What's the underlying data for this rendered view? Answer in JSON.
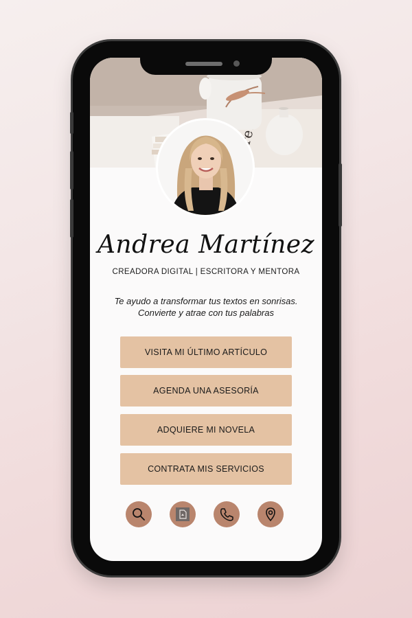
{
  "profile": {
    "name": "Andrea Martínez",
    "subtitle": "CREADORA DIGITAL | ESCRITORA Y MENTORA",
    "tagline_line1": "Te ayudo a transformar tus textos en sonrisas.",
    "tagline_line2": "Convierte y atrae con tus palabras"
  },
  "buttons": [
    {
      "label": "VISITA MI ÚLTIMO ARTÍCULO"
    },
    {
      "label": "AGENDA UNA ASESORÍA"
    },
    {
      "label": "ADQUIERE MI NOVELA"
    },
    {
      "label": "CONTRATA MIS SERVICIOS"
    }
  ],
  "icons": [
    "search-icon",
    "document-icon",
    "phone-icon",
    "location-pin-icon"
  ],
  "colors": {
    "button_bg": "#e4c2a3",
    "icon_circle": "#b9856d",
    "phone_frame": "#0a0a0a"
  }
}
